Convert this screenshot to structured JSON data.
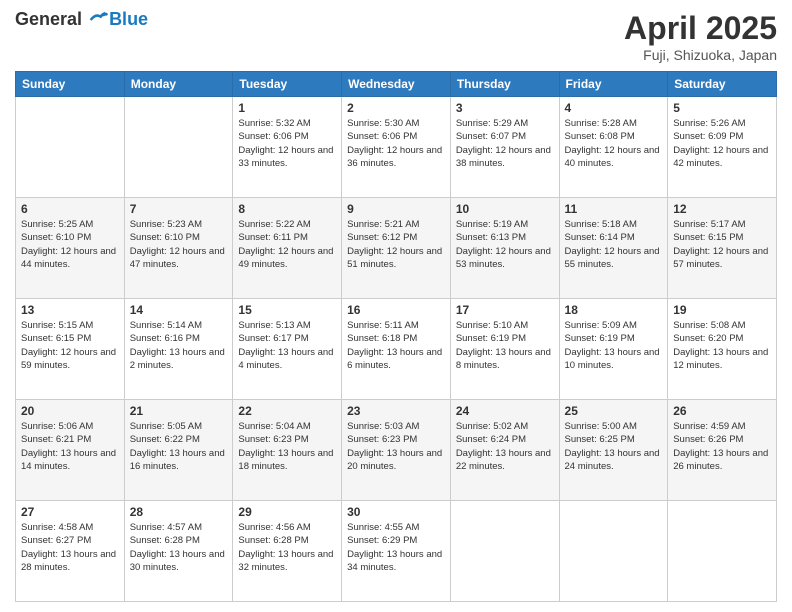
{
  "header": {
    "logo_line1": "General",
    "logo_line2": "Blue",
    "month_title": "April 2025",
    "location": "Fuji, Shizuoka, Japan"
  },
  "days_of_week": [
    "Sunday",
    "Monday",
    "Tuesday",
    "Wednesday",
    "Thursday",
    "Friday",
    "Saturday"
  ],
  "weeks": [
    [
      {
        "day": "",
        "info": ""
      },
      {
        "day": "",
        "info": ""
      },
      {
        "day": "1",
        "info": "Sunrise: 5:32 AM\nSunset: 6:06 PM\nDaylight: 12 hours and 33 minutes."
      },
      {
        "day": "2",
        "info": "Sunrise: 5:30 AM\nSunset: 6:06 PM\nDaylight: 12 hours and 36 minutes."
      },
      {
        "day": "3",
        "info": "Sunrise: 5:29 AM\nSunset: 6:07 PM\nDaylight: 12 hours and 38 minutes."
      },
      {
        "day": "4",
        "info": "Sunrise: 5:28 AM\nSunset: 6:08 PM\nDaylight: 12 hours and 40 minutes."
      },
      {
        "day": "5",
        "info": "Sunrise: 5:26 AM\nSunset: 6:09 PM\nDaylight: 12 hours and 42 minutes."
      }
    ],
    [
      {
        "day": "6",
        "info": "Sunrise: 5:25 AM\nSunset: 6:10 PM\nDaylight: 12 hours and 44 minutes."
      },
      {
        "day": "7",
        "info": "Sunrise: 5:23 AM\nSunset: 6:10 PM\nDaylight: 12 hours and 47 minutes."
      },
      {
        "day": "8",
        "info": "Sunrise: 5:22 AM\nSunset: 6:11 PM\nDaylight: 12 hours and 49 minutes."
      },
      {
        "day": "9",
        "info": "Sunrise: 5:21 AM\nSunset: 6:12 PM\nDaylight: 12 hours and 51 minutes."
      },
      {
        "day": "10",
        "info": "Sunrise: 5:19 AM\nSunset: 6:13 PM\nDaylight: 12 hours and 53 minutes."
      },
      {
        "day": "11",
        "info": "Sunrise: 5:18 AM\nSunset: 6:14 PM\nDaylight: 12 hours and 55 minutes."
      },
      {
        "day": "12",
        "info": "Sunrise: 5:17 AM\nSunset: 6:15 PM\nDaylight: 12 hours and 57 minutes."
      }
    ],
    [
      {
        "day": "13",
        "info": "Sunrise: 5:15 AM\nSunset: 6:15 PM\nDaylight: 12 hours and 59 minutes."
      },
      {
        "day": "14",
        "info": "Sunrise: 5:14 AM\nSunset: 6:16 PM\nDaylight: 13 hours and 2 minutes."
      },
      {
        "day": "15",
        "info": "Sunrise: 5:13 AM\nSunset: 6:17 PM\nDaylight: 13 hours and 4 minutes."
      },
      {
        "day": "16",
        "info": "Sunrise: 5:11 AM\nSunset: 6:18 PM\nDaylight: 13 hours and 6 minutes."
      },
      {
        "day": "17",
        "info": "Sunrise: 5:10 AM\nSunset: 6:19 PM\nDaylight: 13 hours and 8 minutes."
      },
      {
        "day": "18",
        "info": "Sunrise: 5:09 AM\nSunset: 6:19 PM\nDaylight: 13 hours and 10 minutes."
      },
      {
        "day": "19",
        "info": "Sunrise: 5:08 AM\nSunset: 6:20 PM\nDaylight: 13 hours and 12 minutes."
      }
    ],
    [
      {
        "day": "20",
        "info": "Sunrise: 5:06 AM\nSunset: 6:21 PM\nDaylight: 13 hours and 14 minutes."
      },
      {
        "day": "21",
        "info": "Sunrise: 5:05 AM\nSunset: 6:22 PM\nDaylight: 13 hours and 16 minutes."
      },
      {
        "day": "22",
        "info": "Sunrise: 5:04 AM\nSunset: 6:23 PM\nDaylight: 13 hours and 18 minutes."
      },
      {
        "day": "23",
        "info": "Sunrise: 5:03 AM\nSunset: 6:23 PM\nDaylight: 13 hours and 20 minutes."
      },
      {
        "day": "24",
        "info": "Sunrise: 5:02 AM\nSunset: 6:24 PM\nDaylight: 13 hours and 22 minutes."
      },
      {
        "day": "25",
        "info": "Sunrise: 5:00 AM\nSunset: 6:25 PM\nDaylight: 13 hours and 24 minutes."
      },
      {
        "day": "26",
        "info": "Sunrise: 4:59 AM\nSunset: 6:26 PM\nDaylight: 13 hours and 26 minutes."
      }
    ],
    [
      {
        "day": "27",
        "info": "Sunrise: 4:58 AM\nSunset: 6:27 PM\nDaylight: 13 hours and 28 minutes."
      },
      {
        "day": "28",
        "info": "Sunrise: 4:57 AM\nSunset: 6:28 PM\nDaylight: 13 hours and 30 minutes."
      },
      {
        "day": "29",
        "info": "Sunrise: 4:56 AM\nSunset: 6:28 PM\nDaylight: 13 hours and 32 minutes."
      },
      {
        "day": "30",
        "info": "Sunrise: 4:55 AM\nSunset: 6:29 PM\nDaylight: 13 hours and 34 minutes."
      },
      {
        "day": "",
        "info": ""
      },
      {
        "day": "",
        "info": ""
      },
      {
        "day": "",
        "info": ""
      }
    ]
  ]
}
